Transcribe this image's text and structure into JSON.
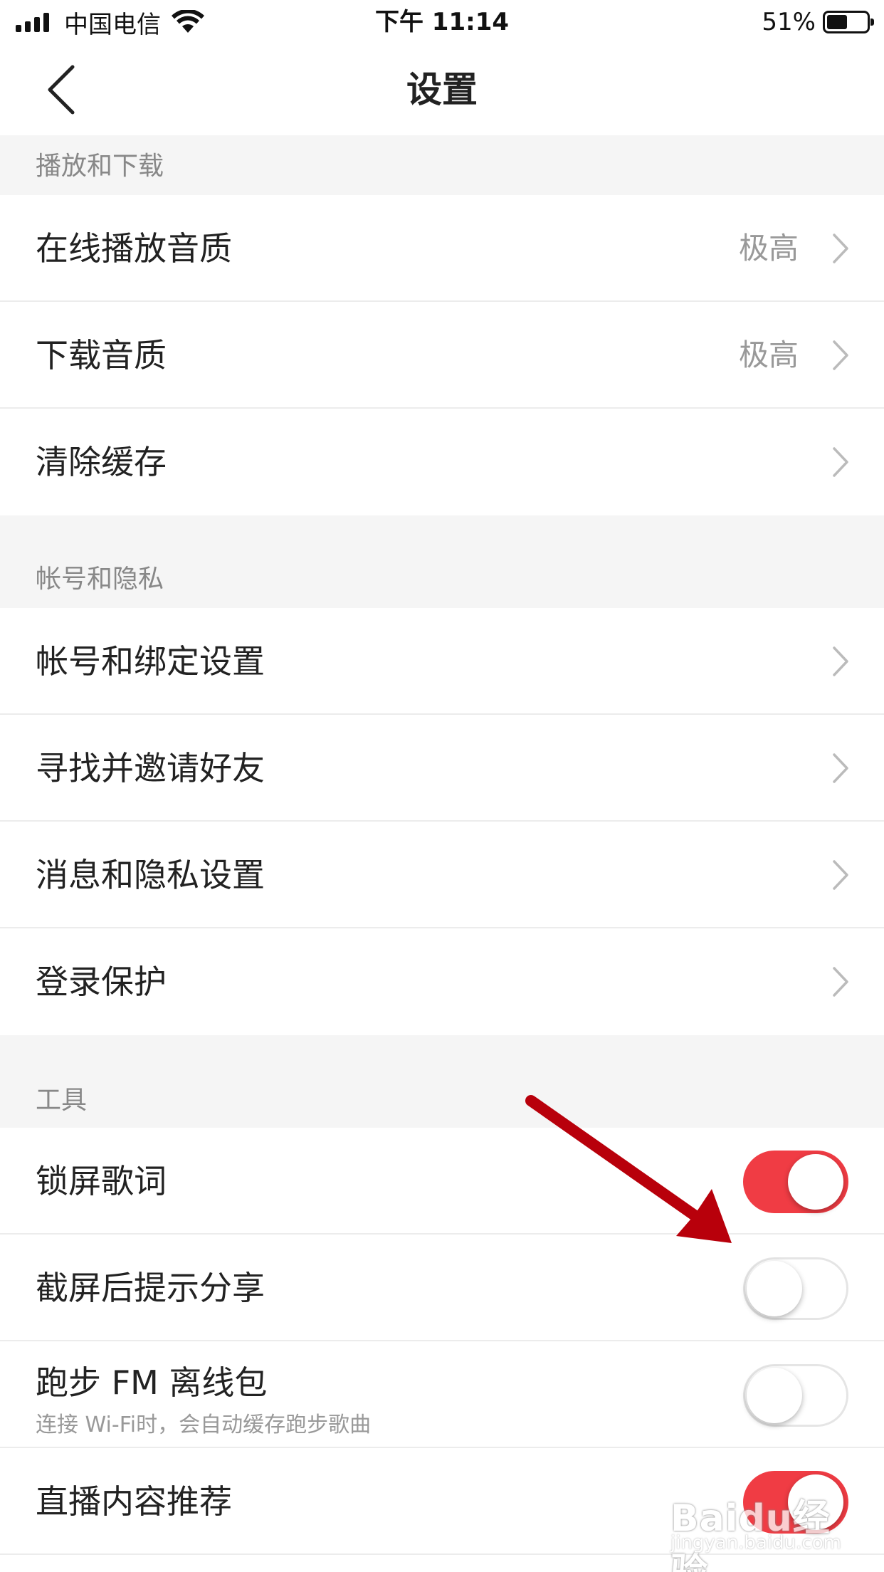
{
  "status": {
    "carrier": "中国电信",
    "time": "下午 11:14",
    "battery": "51%",
    "battery_level": 0.51
  },
  "nav": {
    "title": "设置",
    "back_icon": "chevron-left-icon"
  },
  "sections": {
    "playback": {
      "header": "播放和下载",
      "items": [
        {
          "label": "在线播放音质",
          "value": "极高"
        },
        {
          "label": "下载音质",
          "value": "极高"
        },
        {
          "label": "清除缓存",
          "value": ""
        }
      ]
    },
    "account": {
      "header": "帐号和隐私",
      "items": [
        {
          "label": "帐号和绑定设置"
        },
        {
          "label": "寻找并邀请好友"
        },
        {
          "label": "消息和隐私设置"
        },
        {
          "label": "登录保护"
        }
      ]
    },
    "tools": {
      "header": "工具",
      "items": [
        {
          "label": "锁屏歌词",
          "on": true
        },
        {
          "label": "截屏后提示分享",
          "on": false
        },
        {
          "label": "跑步 FM 离线包",
          "sub": "连接 Wi-Fi时，会自动缓存跑步歌曲",
          "on": false
        },
        {
          "label": "直播内容推荐",
          "on": true
        }
      ]
    }
  },
  "watermark": {
    "brand": "Baidu经验",
    "sub": "jingyan.baidu.com"
  },
  "colors": {
    "accent": "#f03c44",
    "arrow": "#b8000b"
  }
}
